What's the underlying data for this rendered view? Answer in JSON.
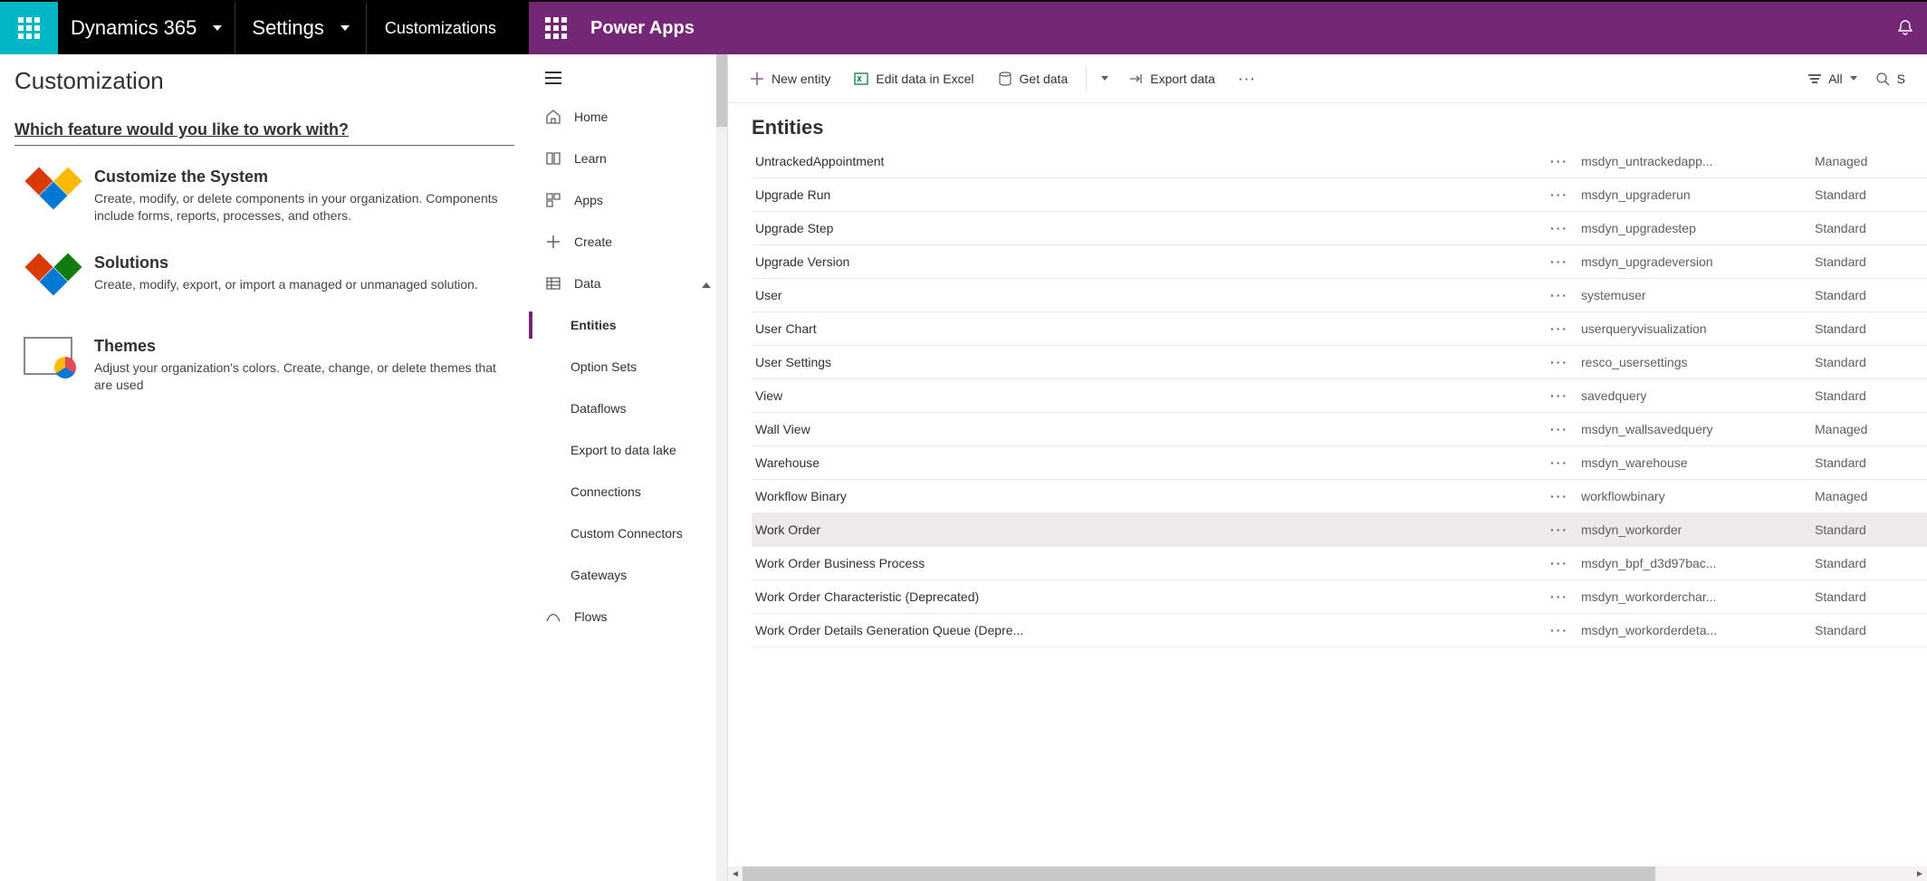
{
  "dynamics": {
    "brand": "Dynamics 365",
    "settings": "Settings",
    "crumb": "Customizations",
    "page_title": "Customization",
    "question": "Which feature would you like to work with?",
    "features": [
      {
        "title": "Customize the System",
        "desc": "Create, modify, or delete components in your organization. Components include forms, reports, processes, and others."
      },
      {
        "title": "Solutions",
        "desc": "Create, modify, export, or import a managed or unmanaged solution."
      },
      {
        "title": "Themes",
        "desc": "Adjust your organization's colors. Create, change, or delete themes that are used"
      }
    ]
  },
  "powerapps": {
    "brand": "Power Apps",
    "nav": {
      "home": "Home",
      "learn": "Learn",
      "apps": "Apps",
      "create": "Create",
      "data": "Data",
      "entities": "Entities",
      "option_sets": "Option Sets",
      "dataflows": "Dataflows",
      "export_lake": "Export to data lake",
      "connections": "Connections",
      "custom_connectors": "Custom Connectors",
      "gateways": "Gateways",
      "flows": "Flows"
    },
    "cmd": {
      "new_entity": "New entity",
      "edit_excel": "Edit data in Excel",
      "get_data": "Get data",
      "export_data": "Export data",
      "all": "All",
      "search_hint": "S"
    },
    "grid_title": "Entities",
    "rows": [
      {
        "name": "UntrackedAppointment",
        "schema": "msdyn_untrackedapp...",
        "type": "Managed",
        "sel": false
      },
      {
        "name": "Upgrade Run",
        "schema": "msdyn_upgraderun",
        "type": "Standard",
        "sel": false
      },
      {
        "name": "Upgrade Step",
        "schema": "msdyn_upgradestep",
        "type": "Standard",
        "sel": false
      },
      {
        "name": "Upgrade Version",
        "schema": "msdyn_upgradeversion",
        "type": "Standard",
        "sel": false
      },
      {
        "name": "User",
        "schema": "systemuser",
        "type": "Standard",
        "sel": false
      },
      {
        "name": "User Chart",
        "schema": "userqueryvisualization",
        "type": "Standard",
        "sel": false
      },
      {
        "name": "User Settings",
        "schema": "resco_usersettings",
        "type": "Standard",
        "sel": false
      },
      {
        "name": "View",
        "schema": "savedquery",
        "type": "Standard",
        "sel": false
      },
      {
        "name": "Wall View",
        "schema": "msdyn_wallsavedquery",
        "type": "Managed",
        "sel": false
      },
      {
        "name": "Warehouse",
        "schema": "msdyn_warehouse",
        "type": "Standard",
        "sel": false
      },
      {
        "name": "Workflow Binary",
        "schema": "workflowbinary",
        "type": "Managed",
        "sel": false
      },
      {
        "name": "Work Order",
        "schema": "msdyn_workorder",
        "type": "Standard",
        "sel": true
      },
      {
        "name": "Work Order Business Process",
        "schema": "msdyn_bpf_d3d97bac...",
        "type": "Standard",
        "sel": false
      },
      {
        "name": "Work Order Characteristic (Deprecated)",
        "schema": "msdyn_workorderchar...",
        "type": "Standard",
        "sel": false
      },
      {
        "name": "Work Order Details Generation Queue (Depre...",
        "schema": "msdyn_workorderdeta...",
        "type": "Standard",
        "sel": false
      }
    ]
  }
}
